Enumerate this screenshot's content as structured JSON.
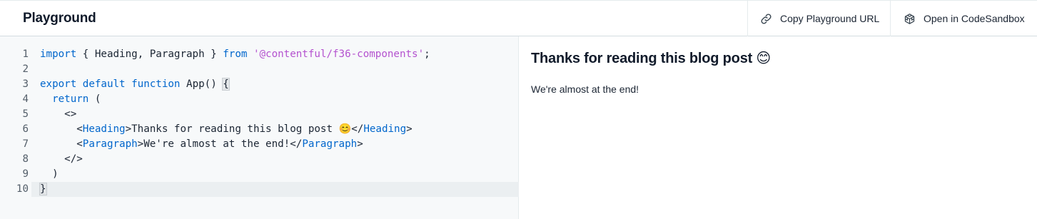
{
  "header": {
    "title": "Playground",
    "copy_url_label": "Copy Playground URL",
    "open_sandbox_label": "Open in CodeSandbox"
  },
  "editor": {
    "lines": [
      {
        "num": "1"
      },
      {
        "num": "2"
      },
      {
        "num": "3"
      },
      {
        "num": "4"
      },
      {
        "num": "5"
      },
      {
        "num": "6"
      },
      {
        "num": "7"
      },
      {
        "num": "8"
      },
      {
        "num": "9"
      },
      {
        "num": "10"
      }
    ],
    "tokens": {
      "import_kw": "import",
      "import_names": " { Heading, Paragraph } ",
      "from_kw": "from",
      "module": "'@contentful/f36-components'",
      "semicolon": ";",
      "export_kw": "export",
      "default_kw": "default",
      "function_kw": "function",
      "app_sig": " App() ",
      "open_brace": "{",
      "return_kw": "return",
      "return_paren": " (",
      "fragment_open": "<>",
      "heading_tag": "Heading",
      "heading_text": "Thanks for reading this blog post 😊",
      "paragraph_tag": "Paragraph",
      "paragraph_text": "We're almost at the end!",
      "fragment_close": "</>",
      "close_paren": ")",
      "close_brace": "}",
      "lt": "<",
      "gt": ">",
      "lt_slash": "</"
    }
  },
  "preview": {
    "heading": "Thanks for reading this blog post 😊",
    "paragraph": "We're almost at the end!"
  },
  "icons": {
    "copy_url": "link-icon",
    "codesandbox": "codesandbox-cube-icon"
  }
}
